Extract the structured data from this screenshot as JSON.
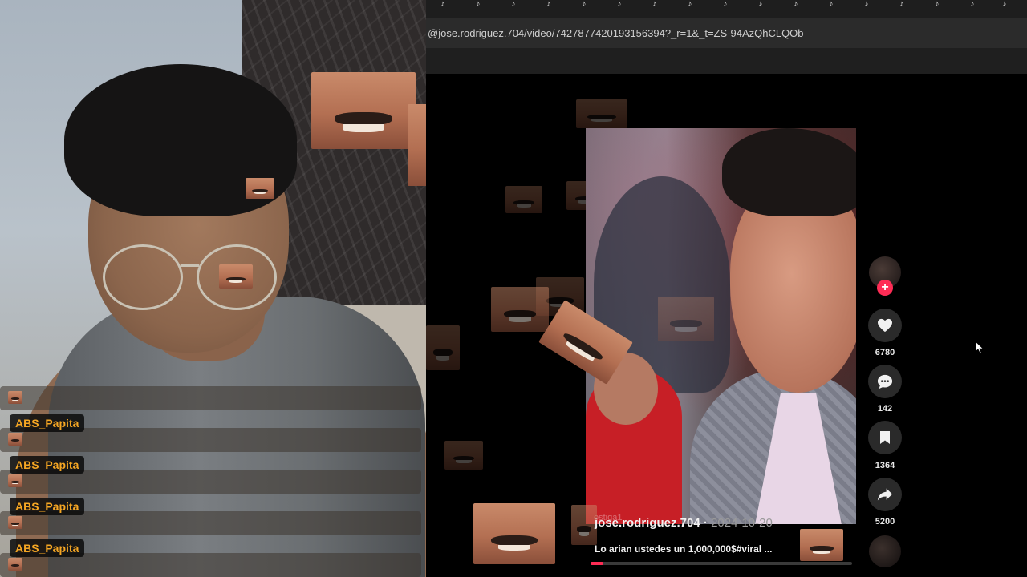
{
  "browser": {
    "url": "@jose.rodriguez.704/video/7427877420193156394?_r=1&_t=ZS-94AzQhCLQOb"
  },
  "chat": {
    "messages": [
      {
        "user": ""
      },
      {
        "user": "ABS_Papita"
      },
      {
        "user": "ABS_Papita"
      },
      {
        "user": "ABS_Papita"
      },
      {
        "user": "ABS_Papita"
      }
    ]
  },
  "video": {
    "author": "jose.rodriguez.704",
    "separator": " · ",
    "date": "2024-10-20",
    "caption": "Lo arian ustedes un 1,000,000$#viral ...",
    "watermark": "ostiga1",
    "progress": 0.05
  },
  "actions": {
    "likes": "6780",
    "comments": "142",
    "saves": "1364",
    "shares": "5200"
  },
  "colors": {
    "accent": "#fe2c55",
    "chat_name": "#f5a623"
  },
  "icons": {
    "follow": "plus-icon",
    "like": "heart-icon",
    "comment": "comment-bubble-icon",
    "save": "bookmark-icon",
    "share": "share-arrow-icon",
    "pointer": "mouse-cursor-icon"
  }
}
